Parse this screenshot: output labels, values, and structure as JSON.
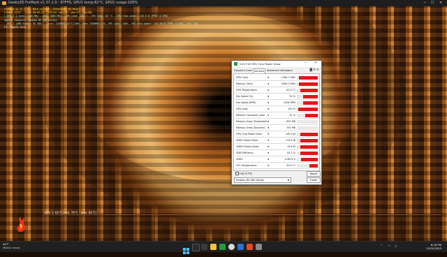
{
  "furmark": {
    "window_title": "Geeks3D FurMark v1.37.2.0 - 87FPS, GPU1 temp:62°C, GPU1 usage:100%",
    "osd_lines": [
      {
        "text": "FurMark v1.37.2.0 - Burn-in test, 1920x1080 (8X MSAA)",
        "color": "yellow"
      },
      {
        "text": "Frames:17227 - time:00:03:17 - FPS:87 (min:87, max:97, avg:88)",
        "color": "yellow"
      },
      {
        "text": "[ GPU-Z ] core: 1280 MHz - mem: 2000 MHz - GPU load: 100 % - GPU temp: 62 °C - GPU chip power: 145.9 W (PPW: 0.596)",
        "color": "cyan"
      },
      {
        "text": "OpenGL renderer: Radeon RX 580 Series",
        "color": "cyan"
      },
      {
        "text": "- GPU 1 (AMD Radeon RX 580) - core: 1280MHz/62°C/100%, mem: 2000MHz/53%, GPU load: 100%, GPU chip power: 145.90 W (PPW: 0.596), fan: 56%",
        "color": "cyan"
      },
      {
        "text": "F1: Toggle help",
        "color": "white"
      }
    ],
    "graph_label": "GPU 1: 62°C (min: 79°C - max: 82°C)"
  },
  "gpuz": {
    "title": "145.9 W GPU Chip Power Draw",
    "tabs": [
      "Graphics Card",
      "Sensors",
      "Advanced",
      "Validation"
    ],
    "active_tab": "Sensors",
    "sensors": [
      {
        "label": "GPU Clock",
        "value": "1280.7 MHz",
        "fill": 0.9
      },
      {
        "label": "Memory Clock",
        "value": "2000.0 MHz",
        "fill": 0.9
      },
      {
        "label": "GPU Temperature",
        "value": "62.0 °C",
        "fill": 0.85
      },
      {
        "label": "Fan Speed (%)",
        "value": "55 %",
        "fill": 0.7
      },
      {
        "label": "Fan Speed (RPM)",
        "value": "2204 RPM",
        "fill": 0.7
      },
      {
        "label": "GPU Load",
        "value": "100 %",
        "fill": 0.95
      },
      {
        "label": "Memory Controller Load",
        "value": "51 %",
        "fill": 0.6
      },
      {
        "label": "Memory Used (Dedicated)",
        "value": "830 MB",
        "fill": 0.0
      },
      {
        "label": "Memory Used (Dynamic)",
        "value": "191 MB",
        "fill": 0.0
      },
      {
        "label": "GPU Chip Power Draw",
        "value": "145.9 W",
        "fill": 0.85
      },
      {
        "label": "VDDC Power Draw",
        "value": "114.9 W",
        "fill": 0.85
      },
      {
        "label": "VDDCI Power Draw",
        "value": "13.6 W",
        "fill": 0.85
      },
      {
        "label": "VRM Efficiency",
        "value": "93.1 %",
        "fill": 0.85
      },
      {
        "label": "VDDC",
        "value": "0.9879 V",
        "fill": 0.8
      },
      {
        "label": "CPU Temperature",
        "value": "39.0 °C",
        "fill": 0.4
      }
    ],
    "log_label": "Log to file",
    "reset_label": "Reset",
    "gpu_select": "Radeon RX 580 Series",
    "close_label": "Close"
  },
  "taskbar": {
    "weather_temp": "34°F",
    "weather_desc": "Mostly cloudy",
    "clock_time": "6:18 PM",
    "clock_date": "12/31/2023"
  },
  "colors": {
    "bar_fill": "#e01818",
    "osd_yellow": "#f4e04a",
    "osd_cyan": "#8cf0f0",
    "taskbar_bg": "#202020"
  }
}
